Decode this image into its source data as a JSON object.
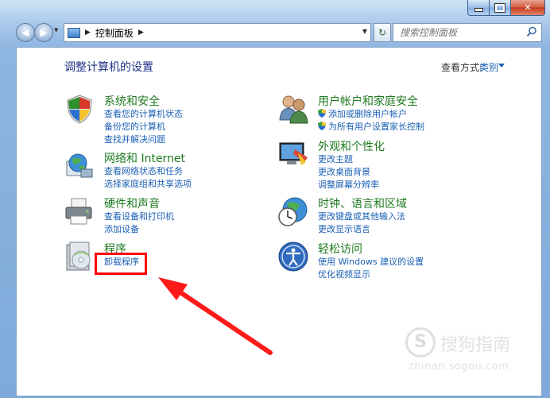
{
  "window": {
    "minimize_icon": "minimize-icon",
    "maximize_icon": "maximize-icon",
    "close_glyph": "✕"
  },
  "navbar": {
    "breadcrumb": "控制面板",
    "search_placeholder": "搜索控制面板"
  },
  "header": {
    "title": "调整计算机的设置",
    "view_by_label": "查看方式:",
    "view_by_value": "类别"
  },
  "categories": {
    "system": {
      "title": "系统和安全",
      "links": [
        "查看您的计算机状态",
        "备份您的计算机",
        "查找并解决问题"
      ]
    },
    "network": {
      "title": "网络和 Internet",
      "links": [
        "查看网络状态和任务",
        "选择家庭组和共享选项"
      ]
    },
    "hardware": {
      "title": "硬件和声音",
      "links": [
        "查看设备和打印机",
        "添加设备"
      ]
    },
    "programs": {
      "title": "程序",
      "links": [
        "卸载程序"
      ]
    },
    "users": {
      "title": "用户帐户和家庭安全",
      "links": [
        "添加或删除用户帐户",
        "为所有用户设置家长控制"
      ]
    },
    "appearance": {
      "title": "外观和个性化",
      "links": [
        "更改主题",
        "更改桌面背景",
        "调整屏幕分辨率"
      ]
    },
    "clock": {
      "title": "时钟、语言和区域",
      "links": [
        "更改键盘或其他输入法",
        "更改显示语言"
      ]
    },
    "ease": {
      "title": "轻松访问",
      "links": [
        "使用 Windows 建议的设置",
        "优化视频显示"
      ]
    }
  },
  "watermark": {
    "glyph": "S",
    "text": "搜狗指南",
    "url": "zhinan.sogou.com"
  },
  "colors": {
    "accent_link": "#1a5fb4",
    "category_title": "#1f7a1f",
    "annotation": "#ff0000"
  }
}
